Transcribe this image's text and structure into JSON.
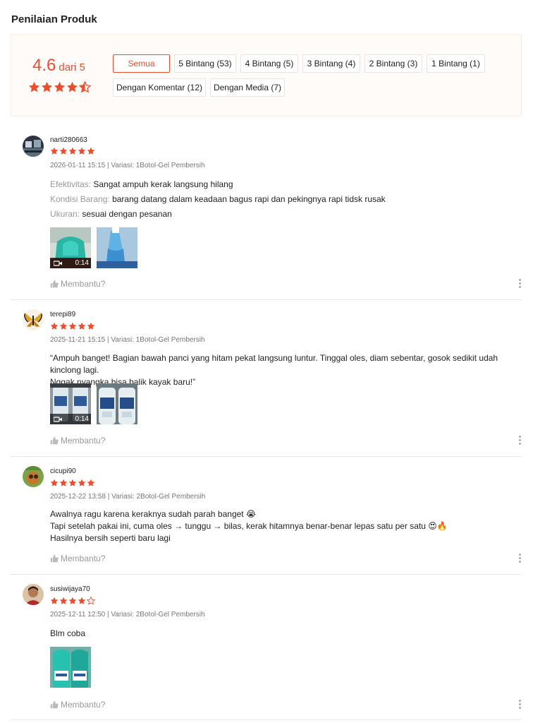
{
  "title": "Penilaian Produk",
  "summary": {
    "score": "4.6",
    "out_of": "dari 5",
    "rating": 4.6
  },
  "filters": [
    {
      "label": "Semua",
      "active": true
    },
    {
      "label": "5 Bintang (53)"
    },
    {
      "label": "4 Bintang (5)"
    },
    {
      "label": "3 Bintang (4)"
    },
    {
      "label": "2 Bintang (3)"
    },
    {
      "label": "1 Bintang (1)"
    },
    {
      "label": "Dengan Komentar (12)"
    },
    {
      "label": "Dengan Media (7)"
    }
  ],
  "reviews": [
    {
      "username": "narti280663",
      "stars": 5,
      "meta": "2026-01-11 15:15 | Variasi: 1Botol-Gel Pembersih",
      "attributes": [
        {
          "key": "Efektivitas:",
          "value": "Sangat ampuh kerak langsung hilang"
        },
        {
          "key": "Kondisi Barang:",
          "value": "barang datang dalam keadaan bagus rapi dan pekingnya rapi tidsk rusak"
        },
        {
          "key": "Ukuran:",
          "value": "sesuai dengan pesanan"
        }
      ],
      "video_duration": "0:14",
      "helpful": "Membantu?"
    },
    {
      "username": "terepi89",
      "stars": 5,
      "meta": "2025-11-21 15:15 | Variasi: 1Botol-Gel Pembersih",
      "text_lines": [
        "“Ampuh banget! Bagian bawah panci yang hitam pekat langsung luntur. Tinggal oles, diam sebentar, gosok sedikit udah kinclong lagi.",
        "Nggak nyangka bisa balik kayak baru!”"
      ],
      "video_duration": "0:14",
      "helpful": "Membantu?"
    },
    {
      "username": "cicupi90",
      "stars": 5,
      "meta": "2025-12-22 13:58 | Variasi: 2Botol-Gel Pembersih",
      "text_lines": [
        "Awalnya ragu karena keraknya sudah parah banget 😭",
        "Tapi setelah pakai ini, cuma oles → tunggu → bilas, kerak hitamnya benar-benar lepas satu per satu 😍🔥",
        "Hasilnya bersih seperti baru lagi"
      ],
      "helpful": "Membantu?"
    },
    {
      "username": "susiwijaya70",
      "stars": 4,
      "meta": "2025-12-11 12:50 | Variasi: 2Botol-Gel Pembersih",
      "text_lines": [
        "Blm coba"
      ],
      "helpful": "Membantu?"
    }
  ],
  "colors": {
    "accent": "#ee4d2d",
    "summary_bg": "#fffbf8"
  }
}
